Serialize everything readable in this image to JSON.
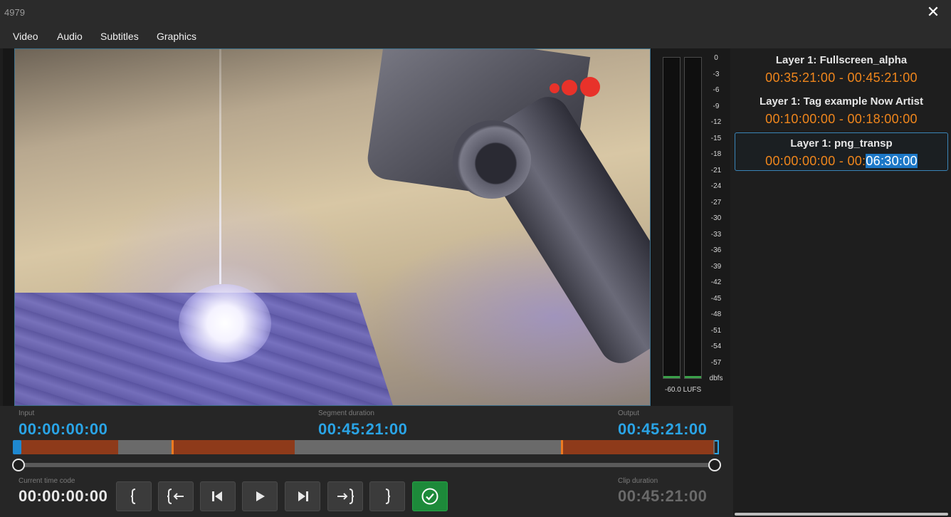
{
  "window": {
    "title": "4979",
    "close_glyph": "✕"
  },
  "menu": {
    "items": [
      "Video",
      "Audio",
      "Subtitles",
      "Graphics"
    ]
  },
  "meter": {
    "scale": [
      "0",
      "-3",
      "-6",
      "-9",
      "-12",
      "-15",
      "-18",
      "-21",
      "-24",
      "-27",
      "-30",
      "-33",
      "-36",
      "-39",
      "-42",
      "-45",
      "-48",
      "-51",
      "-54",
      "-57",
      "dbfs"
    ],
    "lufs": "-60.0 LUFS"
  },
  "layers": [
    {
      "name": "Layer 1: Fullscreen_alpha",
      "start": "00:35:21:00",
      "sep": " - ",
      "end": "00:45:21:00"
    },
    {
      "name": "Layer 1: Tag example Now Artist",
      "start": "00:10:00:00",
      "sep": " - ",
      "end": "00:18:00:00"
    },
    {
      "name": "Layer 1: png_transp",
      "start": "00:00:00:00",
      "sep": " - ",
      "end_prefix": "00:",
      "end_selected": "06:30:00"
    }
  ],
  "timecodes": {
    "input_label": "Input",
    "input": "00:00:00:00",
    "segment_label": "Segment duration",
    "segment": "00:45:21:00",
    "output_label": "Output",
    "output": "00:45:21:00",
    "current_label": "Current time code",
    "current": "00:00:00:00",
    "clip_label": "Clip duration",
    "clip": "00:45:21:00"
  },
  "buttons": [
    "mark-in",
    "go-to-in",
    "step-back",
    "play",
    "step-forward",
    "go-to-out",
    "mark-out",
    "confirm"
  ],
  "colors": {
    "accent_blue": "#2aa4e6",
    "layer_time_orange": "#f0861c",
    "segment_red": "#8e3a1a",
    "confirm_green": "#1d8a3a"
  }
}
